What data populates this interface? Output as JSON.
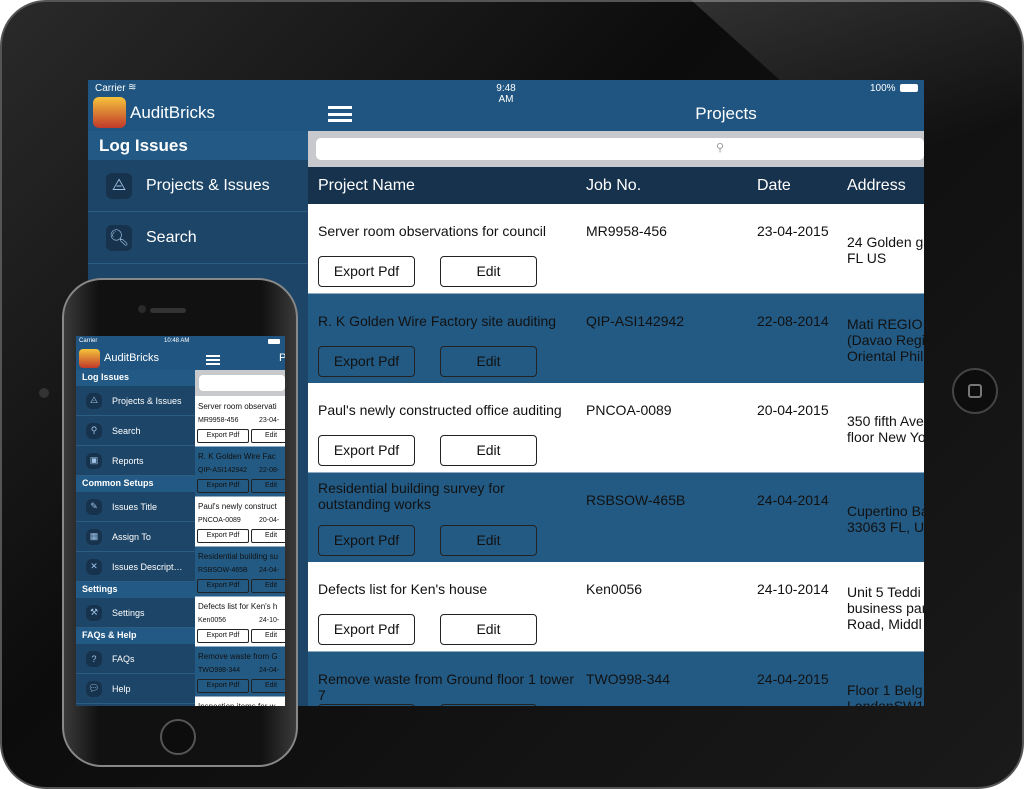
{
  "colors": {
    "nav": "#1f5580",
    "sidebar": "#1d4567",
    "section_header": "#235a85",
    "table_header": "#17324d",
    "row_blue": "#235a84",
    "row_white": "#ffffff"
  },
  "ipad": {
    "status": {
      "carrier": "Carrier",
      "time": "9:48 AM",
      "battery": "100%"
    },
    "app_name": "AuditBricks",
    "title": "Projects",
    "search_placeholder": "",
    "sidebar": {
      "section": "Log Issues",
      "items": [
        {
          "label": "Projects & Issues",
          "icon": "app-store-icon"
        },
        {
          "label": "Search",
          "icon": "magnifier-icon"
        }
      ]
    },
    "columns": [
      "Project Name",
      "Job No.",
      "Date",
      "Address"
    ],
    "export_label": "Export Pdf",
    "edit_label": "Edit",
    "rows": [
      {
        "name": "Server room observations for council",
        "job": "MR9958-456",
        "date": "23-04-2015",
        "address": "24 Golden ga\nFL US"
      },
      {
        "name": "R. K Golden Wire Factory site auditing",
        "job": "QIP-ASI142942",
        "date": "22-08-2014",
        "address": "Mati REGIO\n(Davao Regi\nOriental Phil"
      },
      {
        "name": "Paul's newly constructed office auditing",
        "job": "PNCOA-0089",
        "date": "20-04-2015",
        "address": "350 fifth Ave\nfloor New Yo"
      },
      {
        "name": "Residential building survey for outstanding works",
        "job": "RSBSOW-465B",
        "date": "24-04-2014",
        "address": "Cupertino Ba\n33063 FL, U"
      },
      {
        "name": "Defects list for Ken's house",
        "job": "Ken0056",
        "date": "24-10-2014",
        "address": "Unit 5 Teddi\nbusiness par\nRoad, Middl"
      },
      {
        "name": "Remove waste from Ground floor 1 tower 7",
        "job": "TWO998-344",
        "date": "24-04-2015",
        "address": "Floor 1 Belg\nLondonSW1"
      }
    ]
  },
  "iphone": {
    "status": {
      "carrier": "Carrier",
      "time": "10:48 AM"
    },
    "app_name": "AuditBricks",
    "title_partial": "P",
    "sections": [
      {
        "title": "Log Issues",
        "items": [
          {
            "label": "Projects & Issues",
            "icon": "app-store-icon"
          },
          {
            "label": "Search",
            "icon": "magnifier-icon"
          },
          {
            "label": "Reports",
            "icon": "report-icon"
          }
        ]
      },
      {
        "title": "Common Setups",
        "items": [
          {
            "label": "Issues Title",
            "icon": "note-icon"
          },
          {
            "label": "Assign To",
            "icon": "bricks-icon"
          },
          {
            "label": "Issues Descript…",
            "icon": "cross-icon"
          }
        ]
      },
      {
        "title": "Settings",
        "items": [
          {
            "label": "Settings",
            "icon": "hammer-icon"
          }
        ]
      },
      {
        "title": "FAQs & Help",
        "items": [
          {
            "label": "FAQs",
            "icon": "question-icon"
          },
          {
            "label": "Help",
            "icon": "chat-bubbles-icon"
          }
        ]
      }
    ],
    "export_label": "Export Pdf",
    "edit_label": "Edit",
    "rows": [
      {
        "name": "Server room observati",
        "job": "MR9958-456",
        "date": "23-04-"
      },
      {
        "name": "R. K Golden Wire Fac",
        "job": "QIP-ASI142942",
        "date": "22-08-"
      },
      {
        "name": "Paul's newly construct",
        "job": "PNCOA-0089",
        "date": "20-04-"
      },
      {
        "name": "Residential building su",
        "job": "RSBSOW-465B",
        "date": "24-04-"
      },
      {
        "name": "Defects list for Ken's h",
        "job": "Ken0056",
        "date": "24-10-"
      },
      {
        "name": "Remove waste from G",
        "job": "TWO998-344",
        "date": "24-04-"
      },
      {
        "name": "Inspection items for w",
        "job": "",
        "date": ""
      }
    ]
  }
}
